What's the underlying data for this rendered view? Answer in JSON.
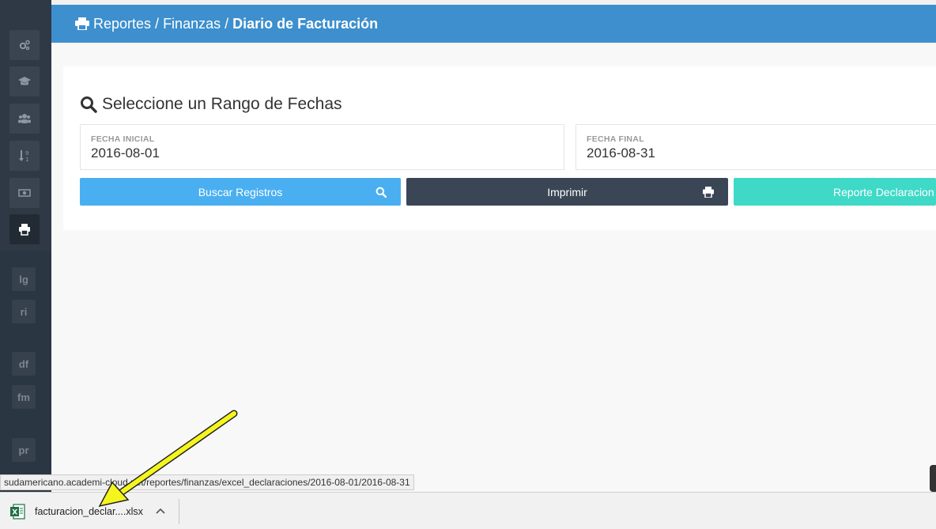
{
  "sidebar": {
    "icons": [
      "cogs-icon",
      "graduation-cap-icon",
      "users-icon",
      "sort-numeric-icon",
      "money-icon",
      "print-icon"
    ],
    "text_items": [
      "lg",
      "ri",
      "df",
      "fm",
      "pr"
    ]
  },
  "breadcrumb": {
    "item1": "Reportes",
    "item2": "Finanzas",
    "current": "Diario de Facturación",
    "separator": "/"
  },
  "card": {
    "title": "Seleccione un Rango de Fechas",
    "start_label": "FECHA INICIAL",
    "start_value": "2016-08-01",
    "end_label": "FECHA FINAL",
    "end_value": "2016-08-31",
    "search_button": "Buscar Registros",
    "print_button": "Imprimir",
    "report_button": "Reporte Declaracion"
  },
  "status_url": "sudamericano.academi-cloud.net/reportes/finanzas/excel_declaraciones/2016-08-01/2016-08-31",
  "downloads": {
    "file_name": "facturacion_declar....xlsx"
  },
  "colors": {
    "header": "#3d8fcd",
    "sidebar": "#2b3643",
    "search_button": "#4aaff0",
    "print_button": "#3a4655",
    "report_button": "#3fd9c7",
    "arrow": "#f5f51e"
  }
}
